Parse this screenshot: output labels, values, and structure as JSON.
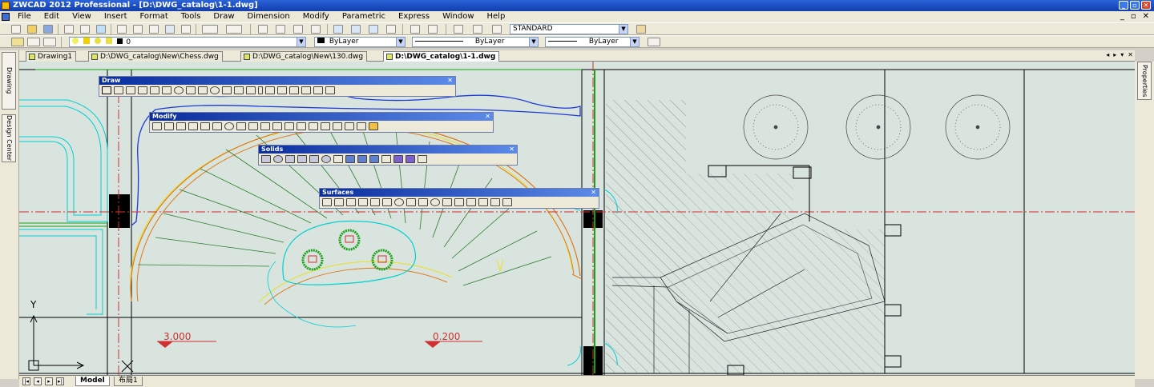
{
  "title": "ZWCAD 2012 Professional - [D:\\DWG_catalog\\1-1.dwg]",
  "menu": [
    "File",
    "Edit",
    "View",
    "Insert",
    "Format",
    "Tools",
    "Draw",
    "Dimension",
    "Modify",
    "Parametric",
    "Express",
    "Window",
    "Help"
  ],
  "mdi_buttons": [
    "_",
    "▫",
    "✕"
  ],
  "toolbar": {
    "text_style": "STANDARD",
    "layer": "0",
    "color": "ByLayer",
    "linetype": "ByLayer",
    "lineweight": "ByLayer"
  },
  "doc_tabs": [
    {
      "label": "Drawing1",
      "active": false
    },
    {
      "label": "D:\\DWG_catalog\\New\\Chess.dwg",
      "active": false
    },
    {
      "label": "D:\\DWG_catalog\\New\\130.dwg",
      "active": false
    },
    {
      "label": "D:\\DWG_catalog\\1-1.dwg",
      "active": true
    }
  ],
  "tab_nav": [
    "◂",
    "▸",
    "▾",
    "✕"
  ],
  "side_tabs_left": [
    "Drawing Recovery",
    "Design Center"
  ],
  "side_tabs_right": [
    "Properties"
  ],
  "palettes": {
    "draw": {
      "title": "Draw",
      "close": "✕"
    },
    "modify": {
      "title": "Modify",
      "close": "✕"
    },
    "solids": {
      "title": "Solids",
      "close": "✕"
    },
    "surfaces": {
      "title": "Surfaces",
      "close": "✕"
    }
  },
  "drawing": {
    "level_a": "3.000",
    "level_b": "0.200",
    "ucs_y": "Y"
  },
  "layout_tabs": [
    {
      "label": "Model",
      "active": true
    },
    {
      "label": "布局1",
      "active": false
    }
  ],
  "nav_buttons": [
    "|◂",
    "◂",
    "▸",
    "▸|"
  ],
  "colors": {
    "accent": "#1a4cc0",
    "canvas": "#d9e4df",
    "axis": "#d03030",
    "cyan": "#00e0e0",
    "orange": "#e07818",
    "green": "#1a7a1a",
    "yellow": "#e8e020"
  }
}
